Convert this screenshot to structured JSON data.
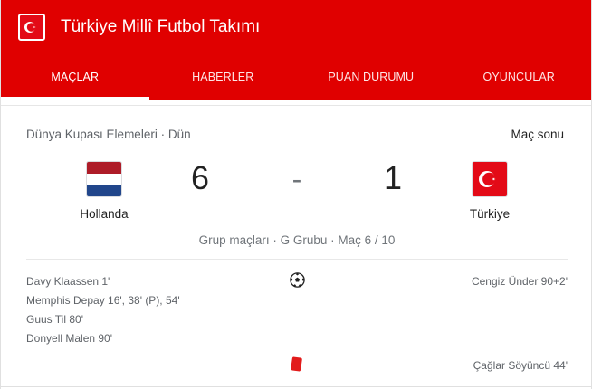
{
  "header": {
    "title": "Türkiye Millî Futbol Takımı",
    "tabs": [
      {
        "label": "MAÇLAR",
        "active": true
      },
      {
        "label": "HABERLER",
        "active": false
      },
      {
        "label": "PUAN DURUMU",
        "active": false
      },
      {
        "label": "OYUNCULAR",
        "active": false
      }
    ],
    "brand_color": "#e00000"
  },
  "match": {
    "competition": "Dünya Kupası Elemeleri · Dün",
    "status": "Maç sonu",
    "home": {
      "name": "Hollanda",
      "score": "6",
      "flag": "netherlands-flag-icon",
      "flag_colors": [
        "#ae1c28",
        "#ffffff",
        "#21468b"
      ]
    },
    "separator": "-",
    "away": {
      "name": "Türkiye",
      "score": "1",
      "flag": "turkey-flag-icon",
      "flag_colors": [
        "#e30a17",
        "#ffffff"
      ]
    },
    "group_info": "Grup maçları · G Grubu · Maç 6 / 10"
  },
  "events": {
    "goals_icon": "soccer-ball-icon",
    "home_scorers": [
      "Davy Klaassen 1'",
      "Memphis Depay 16', 38' (P), 54'",
      "Guus Til 80'",
      "Donyell Malen 90'"
    ],
    "away_scorers": [
      "Cengiz Ünder 90+2'"
    ],
    "red_card_icon": "red-card-icon",
    "away_red_cards": [
      "Çağlar Söyüncü 44'"
    ]
  }
}
